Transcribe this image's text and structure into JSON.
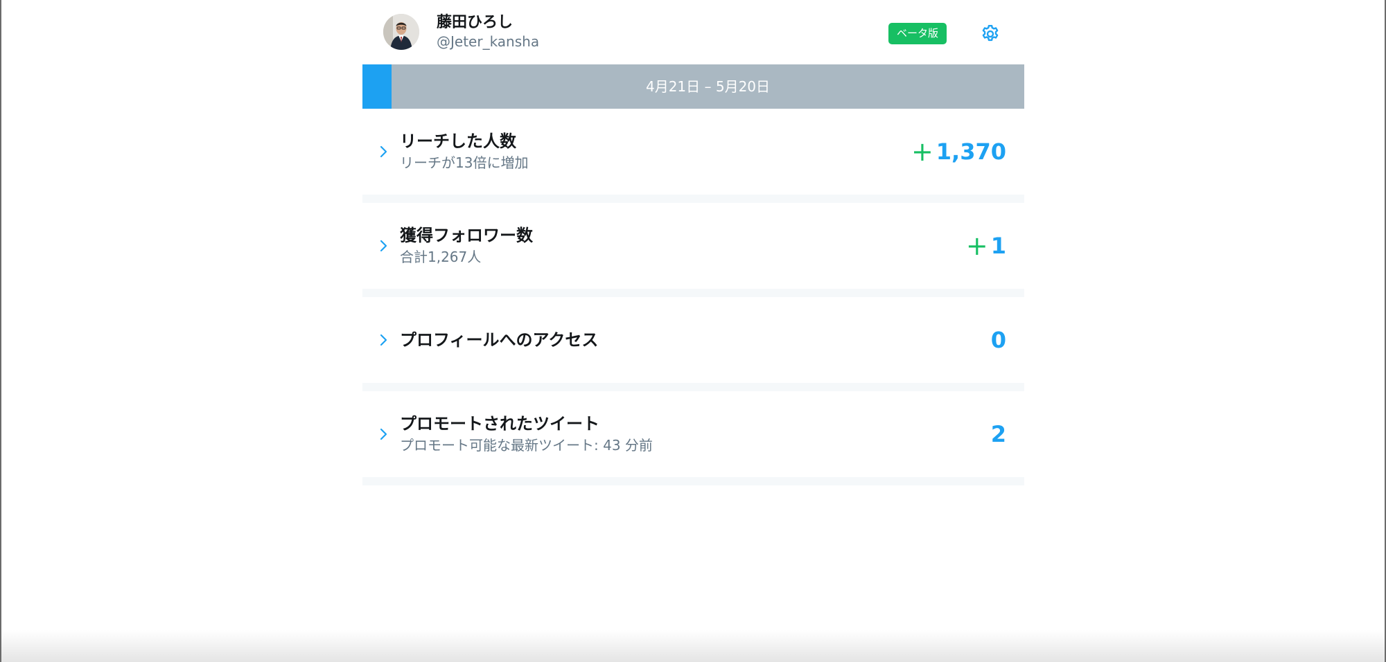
{
  "header": {
    "display_name": "藤田ひろし",
    "handle": "@Jeter_kansha",
    "beta_badge": "ベータ版"
  },
  "date_range": "4月21日 – 5月20日",
  "metrics": [
    {
      "title": "リーチした人数",
      "subtitle": "リーチが13倍に増加",
      "prefix": "+",
      "value": "1,370"
    },
    {
      "title": "獲得フォロワー数",
      "subtitle": "合計1,267人",
      "prefix": "+",
      "value": "1"
    },
    {
      "title": "プロフィールへのアクセス",
      "subtitle": "",
      "prefix": "",
      "value": "0"
    },
    {
      "title": "プロモートされたツイート",
      "subtitle": "プロモート可能な最新ツイート: 43 分前",
      "prefix": "",
      "value": "2"
    }
  ],
  "colors": {
    "accent_blue": "#1da1f2",
    "positive_green": "#17bf63",
    "date_bar_gray": "#aab8c2",
    "muted_text": "#657786"
  },
  "icons": {
    "settings": "gear-icon",
    "row_expand": "chevron-right-icon"
  }
}
